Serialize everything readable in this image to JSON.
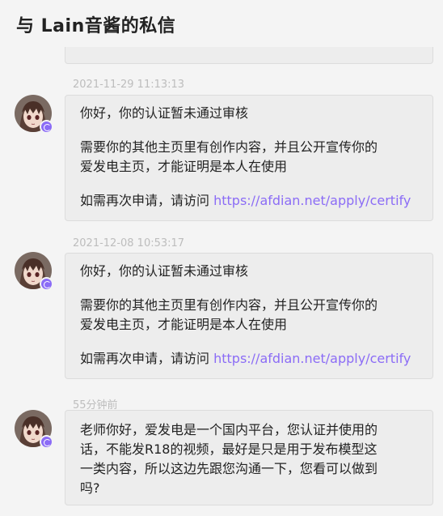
{
  "header": {
    "title": "与 Lain音酱的私信"
  },
  "messages": [
    {
      "time": "2021-11-29 11:13:13",
      "lines": [
        "你好，你的认证暂未通过审核",
        "需要你的其他主页里有创作内容，并且公开宣传你的",
        "爱发电主页，才能证明是本人在使用",
        "如需再次申请，请访问 "
      ],
      "link": "https://afdian.net/apply/certify"
    },
    {
      "time": "2021-12-08 10:53:17",
      "lines": [
        "你好，你的认证暂未通过审核",
        "需要你的其他主页里有创作内容，并且公开宣传你的",
        "爱发电主页，才能证明是本人在使用",
        "如需再次申请，请访问 "
      ],
      "link": "https://afdian.net/apply/certify"
    },
    {
      "time": "55分钟前",
      "lines": [
        "老师你好，爱发电是一个国内平台，您认证并使用的",
        "话，不能发R18的视频，最好是只是用于发布模型这",
        "一类内容，所以这边先跟您沟通一下，您看可以做到",
        "吗?"
      ]
    }
  ],
  "colors": {
    "accent": "#8b6cf6",
    "bubble_bg": "#ededed",
    "timestamp": "#bdbdbd"
  },
  "icons": {
    "avatar": "anime-girl-avatar",
    "badge": "verified-badge-icon"
  }
}
